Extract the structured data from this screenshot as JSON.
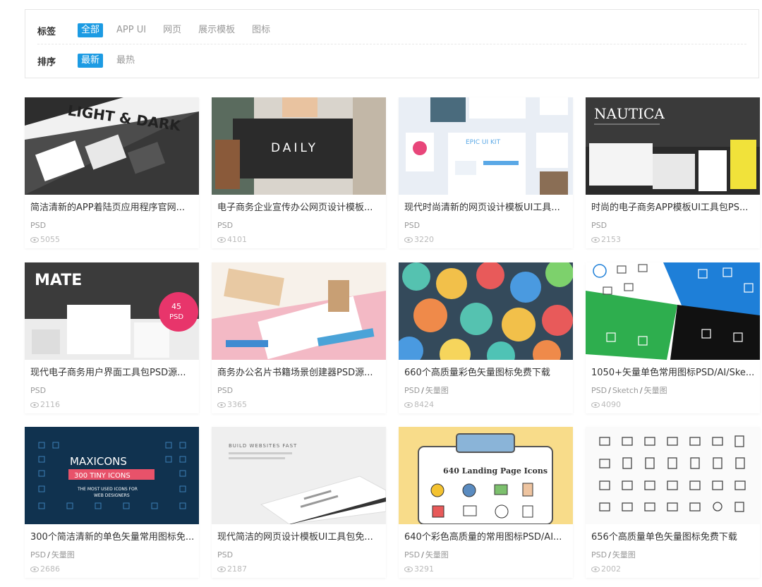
{
  "filters": {
    "tag": {
      "label": "标签",
      "options": [
        "全部",
        "APP UI",
        "网页",
        "展示模板",
        "图标"
      ],
      "active_index": 0
    },
    "sort": {
      "label": "排序",
      "options": [
        "最新",
        "最热"
      ],
      "active_index": 0
    }
  },
  "accent_color": "#1c9be3",
  "cards": [
    {
      "title": "简洁清新的APP着陆页应用程序官网...",
      "tags": [
        "PSD"
      ],
      "views": "5055",
      "thumb_text": "LIGHT & DARK"
    },
    {
      "title": "电子商务企业宣传办公网页设计模板...",
      "tags": [
        "PSD"
      ],
      "views": "4101",
      "thumb_text": "DAILY"
    },
    {
      "title": "现代时尚清新的网页设计模板UI工具...",
      "tags": [
        "PSD"
      ],
      "views": "3220",
      "thumb_text": "EPIC UI KIT"
    },
    {
      "title": "时尚的电子商务APP模板UI工具包PS...",
      "tags": [
        "PSD"
      ],
      "views": "2153",
      "thumb_text": "NAUTICA"
    },
    {
      "title": "现代电子商务用户界面工具包PSD源...",
      "tags": [
        "PSD"
      ],
      "views": "2116",
      "thumb_text": "MATE"
    },
    {
      "title": "商务办公名片书籍场景创建器PSD源...",
      "tags": [
        "PSD"
      ],
      "views": "3365",
      "thumb_text": ""
    },
    {
      "title": "660个高质量彩色矢量图标免费下载",
      "tags": [
        "PSD",
        "矢量图"
      ],
      "views": "8424",
      "thumb_text": ""
    },
    {
      "title": "1050+矢量单色常用图标PSD/AI/Ske...",
      "tags": [
        "PSD",
        "Sketch",
        "矢量图"
      ],
      "views": "4090",
      "thumb_text": ""
    },
    {
      "title": "300个简洁清新的单色矢量常用图标免...",
      "tags": [
        "PSD",
        "矢量图"
      ],
      "views": "2686",
      "thumb_text": "MAXICONS"
    },
    {
      "title": "现代简洁的网页设计模板UI工具包免...",
      "tags": [
        "PSD"
      ],
      "views": "2187",
      "thumb_text": "BUILD WEBSITES FAST"
    },
    {
      "title": "640个彩色高质量的常用图标PSD/AI...",
      "tags": [
        "PSD",
        "矢量图"
      ],
      "views": "3291",
      "thumb_text": "640 Landing Page Icons"
    },
    {
      "title": "656个高质量单色矢量图标免费下载",
      "tags": [
        "PSD",
        "矢量图"
      ],
      "views": "2002",
      "thumb_text": ""
    }
  ]
}
